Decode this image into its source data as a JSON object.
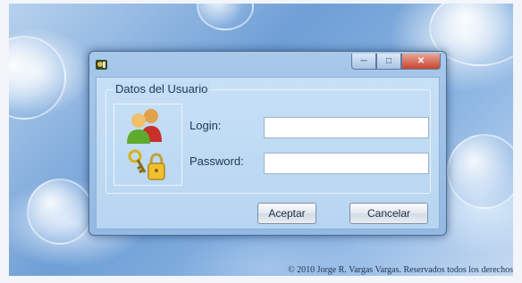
{
  "desktop": {
    "copyright": "© 2010 Jorge R. Vargas Vargas. Reservados todos los derechos"
  },
  "dialog": {
    "title": "",
    "group_title": "Datos del Usuario",
    "login_label": "Login:",
    "login_value": "",
    "password_label": "Password:",
    "password_value": "",
    "accept_label": "Aceptar",
    "cancel_label": "Cancelar"
  },
  "icons": {
    "app": "app-icon",
    "users": "users-icon",
    "keys": "keys-lock-icon",
    "minimize": "minimize-icon",
    "maximize": "maximize-icon",
    "close": "close-icon"
  },
  "colors": {
    "window_frame": "#a8c8ea",
    "close_button": "#c8452f",
    "client_bg": "#c7e0f6"
  }
}
